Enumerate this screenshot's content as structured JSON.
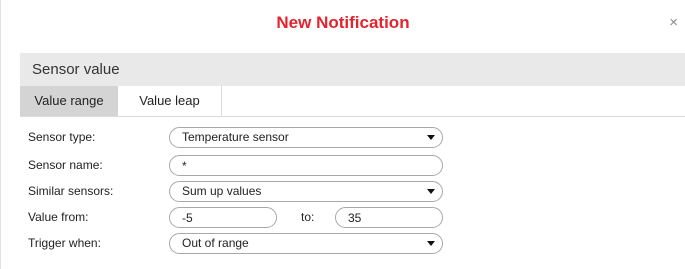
{
  "dialog": {
    "title": "New Notification",
    "close_glyph": "×",
    "title_color": "#e2242e"
  },
  "section": {
    "title": "Sensor value"
  },
  "tabs": [
    {
      "label": "Value range",
      "active": true
    },
    {
      "label": "Value leap",
      "active": false
    }
  ],
  "form": {
    "sensor_type": {
      "label": "Sensor type:",
      "value": "Temperature sensor"
    },
    "sensor_name": {
      "label": "Sensor name:",
      "value": "*"
    },
    "similar_sensors": {
      "label": "Similar sensors:",
      "value": "Sum up values"
    },
    "value_range": {
      "label": "Value from:",
      "from_value": "-5",
      "to_label": "to:",
      "to_value": "35"
    },
    "trigger_when": {
      "label": "Trigger when:",
      "value": "Out of range"
    }
  }
}
